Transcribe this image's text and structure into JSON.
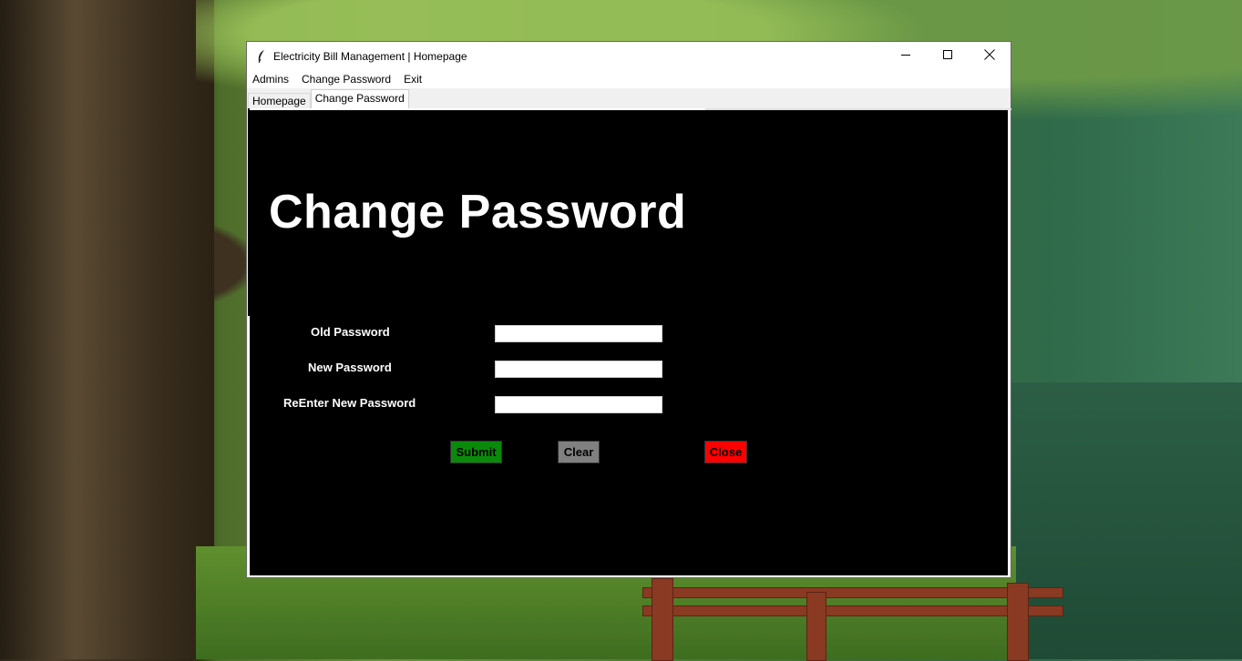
{
  "window": {
    "title": "Electricity Bill Management | Homepage"
  },
  "menu": {
    "items": [
      "Admins",
      "Change Password",
      "Exit"
    ]
  },
  "tabs": [
    "Homepage",
    "Change Password"
  ],
  "form": {
    "heading": "Change Password",
    "fields": [
      {
        "label": "Old Password",
        "value": ""
      },
      {
        "label": "New Password",
        "value": ""
      },
      {
        "label": "ReEnter New Password",
        "value": ""
      }
    ],
    "buttons": {
      "submit": "Submit",
      "clear": "Clear",
      "close": "Close"
    }
  },
  "colors": {
    "submit": "#0a8a0a",
    "clear": "#808080",
    "close": "#ff0000",
    "panel": "#000000"
  },
  "icons": {
    "app": "feather-icon",
    "minimize": "minimize-icon",
    "maximize": "maximize-icon",
    "close": "close-icon"
  }
}
